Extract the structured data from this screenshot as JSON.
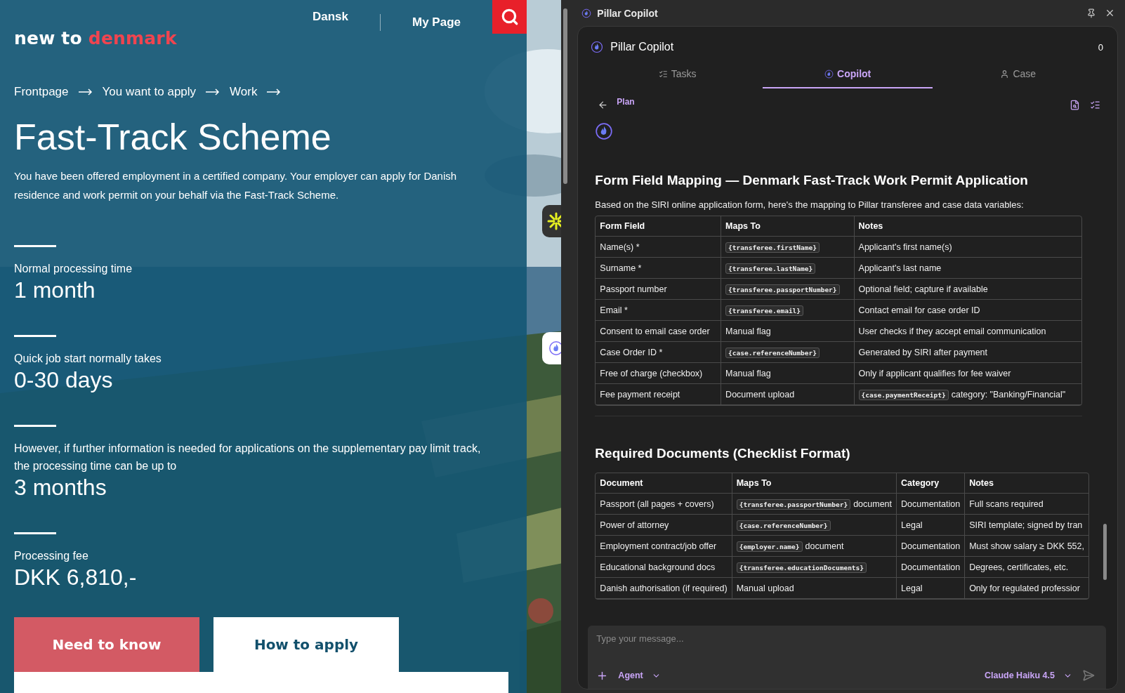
{
  "site": {
    "logo": {
      "first": "new to",
      "second": "denmark"
    },
    "nav": [
      {
        "label": "Dansk"
      },
      {
        "label": "My Page"
      }
    ],
    "breadcrumbs": [
      "Frontpage",
      "You want to apply",
      "Work"
    ],
    "title": "Fast-Track Scheme",
    "intro": "You have been offered employment in a certified company. Your employer can apply for Danish residence and work permit on your behalf via the Fast-Track Scheme.",
    "facts": [
      {
        "label": "Normal processing time",
        "value": "1 month"
      },
      {
        "label": "Quick job start normally takes",
        "value": "0-30 days"
      },
      {
        "label": "However, if further information is needed for applications on the supplementary pay limit track, the processing time can be up to",
        "value": "3 months"
      },
      {
        "label": "Processing fee",
        "value": "DKK 6,810,-"
      }
    ],
    "tabs": [
      {
        "label": "Need to know",
        "selected": false
      },
      {
        "label": "How to apply",
        "selected": true
      }
    ]
  },
  "copilot": {
    "window_title": "Pillar Copilot",
    "title": "Pillar Copilot",
    "counter": "0",
    "tabs": [
      {
        "label": "Tasks",
        "kind": "tasks",
        "selected": false
      },
      {
        "label": "Copilot",
        "kind": "copilot",
        "selected": true
      },
      {
        "label": "Case",
        "kind": "case",
        "selected": false
      }
    ],
    "back_label": "Plan",
    "sections": [
      {
        "heading": "Form Field Mapping — Denmark Fast-Track Work Permit Application",
        "intro": "Based on the SIRI online application form, here's the mapping to Pillar transferee and case data variables:",
        "columns": [
          "Form Field",
          "Maps To",
          "Notes"
        ],
        "rows": [
          [
            {
              "text": "Name(s) *"
            },
            {
              "code": "{transferee.firstName}"
            },
            {
              "text": "Applicant's first name(s)"
            }
          ],
          [
            {
              "text": "Surname *"
            },
            {
              "code": "{transferee.lastName}"
            },
            {
              "text": "Applicant's last name"
            }
          ],
          [
            {
              "text": "Passport number"
            },
            {
              "code": "{transferee.passportNumber}"
            },
            {
              "text": "Optional field; capture if available"
            }
          ],
          [
            {
              "text": "Email *"
            },
            {
              "code": "{transferee.email}"
            },
            {
              "text": "Contact email for case order ID"
            }
          ],
          [
            {
              "text": "Consent to email case order"
            },
            {
              "text": "Manual flag"
            },
            {
              "text": "User checks if they accept email communication"
            }
          ],
          [
            {
              "text": "Case Order ID *"
            },
            {
              "code": "{case.referenceNumber}"
            },
            {
              "text": "Generated by SIRI after payment"
            }
          ],
          [
            {
              "text": "Free of charge (checkbox)"
            },
            {
              "text": "Manual flag"
            },
            {
              "text": "Only if applicant qualifies for fee waiver"
            }
          ],
          [
            {
              "text": "Fee payment receipt"
            },
            {
              "text": "Document upload"
            },
            {
              "code": "{case.paymentReceipt}",
              "text": "category: \"Banking/Financial\""
            }
          ]
        ]
      },
      {
        "heading": "Required Documents (Checklist Format)",
        "columns": [
          "Document",
          "Maps To",
          "Category",
          "Notes"
        ],
        "rows": [
          [
            {
              "text": "Passport (all pages + covers)"
            },
            {
              "code": "{transferee.passportNumber}",
              "text": "document"
            },
            {
              "text": "Documentation"
            },
            {
              "text": "Full scans required"
            }
          ],
          [
            {
              "text": "Power of attorney"
            },
            {
              "code": "{case.referenceNumber}"
            },
            {
              "text": "Legal"
            },
            {
              "text": "SIRI template; signed by tran"
            }
          ],
          [
            {
              "text": "Employment contract/job offer"
            },
            {
              "code": "{employer.name}",
              "text": "document"
            },
            {
              "text": "Documentation"
            },
            {
              "text": "Must show salary ≥ DKK 552,"
            }
          ],
          [
            {
              "text": "Educational background docs"
            },
            {
              "code": "{transferee.educationDocuments}"
            },
            {
              "text": "Documentation"
            },
            {
              "text": "Degrees, certificates, etc."
            }
          ],
          [
            {
              "text": "Danish authorisation (if required)"
            },
            {
              "text": "Manual upload"
            },
            {
              "text": "Legal"
            },
            {
              "text": "Only for regulated professior"
            }
          ]
        ]
      }
    ],
    "composer": {
      "placeholder": "Type your message...",
      "mode": "Agent",
      "model": "Claude Haiku 4.5"
    }
  }
}
